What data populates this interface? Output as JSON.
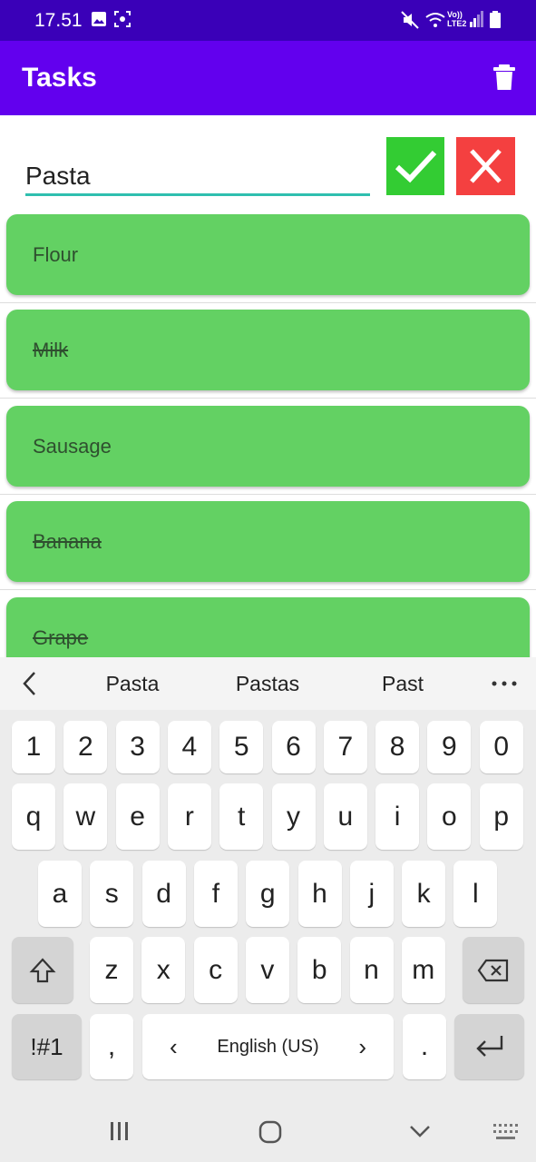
{
  "status_bar": {
    "time": "17.51",
    "network_label": "Vo)) LTE2"
  },
  "app_bar": {
    "title": "Tasks",
    "delete_icon": "trash-icon",
    "color": "#6200ee"
  },
  "input": {
    "value": "Pasta",
    "confirm_icon": "checkmark-icon",
    "cancel_icon": "close-icon"
  },
  "tasks": [
    {
      "label": "Flour",
      "done": false
    },
    {
      "label": "Milk",
      "done": true
    },
    {
      "label": "Sausage",
      "done": false
    },
    {
      "label": "Banana",
      "done": true
    },
    {
      "label": "Grape",
      "done": true
    }
  ],
  "keyboard": {
    "suggestions": [
      "Pasta",
      "Pastas",
      "Past"
    ],
    "row_numbers": [
      "1",
      "2",
      "3",
      "4",
      "5",
      "6",
      "7",
      "8",
      "9",
      "0"
    ],
    "row_1": [
      "q",
      "w",
      "e",
      "r",
      "t",
      "y",
      "u",
      "i",
      "o",
      "p"
    ],
    "row_2": [
      "a",
      "s",
      "d",
      "f",
      "g",
      "h",
      "j",
      "k",
      "l"
    ],
    "row_3": [
      "z",
      "x",
      "c",
      "v",
      "b",
      "n",
      "m"
    ],
    "symbols_key": "!#1",
    "comma_key": ",",
    "space_left": "‹",
    "language": "English (US)",
    "space_right": "›",
    "period_key": "."
  }
}
